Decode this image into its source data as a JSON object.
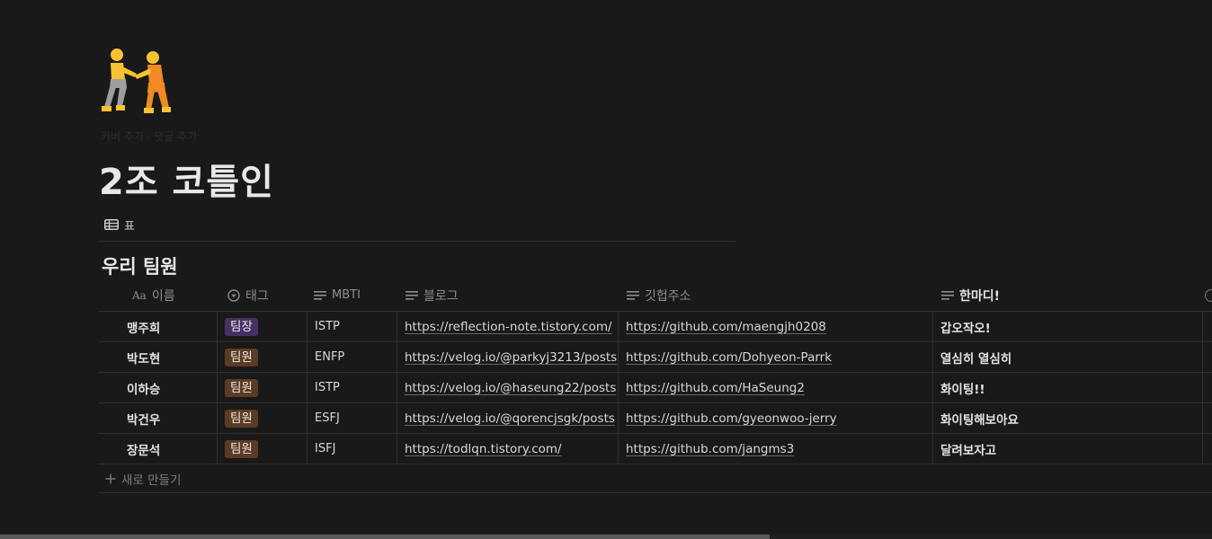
{
  "page": {
    "icon": "wrestlers-emoji",
    "hover_actions": "커버 추가  ·  댓글 추가",
    "title": "2조 코틀인"
  },
  "view": {
    "icon": "table-icon",
    "label": "표"
  },
  "database": {
    "title": "우리 팀원",
    "columns": [
      {
        "icon": "Aa",
        "label": "이름"
      },
      {
        "icon": "select-icon",
        "label": "태그"
      },
      {
        "icon": "text-icon",
        "label": "MBTI"
      },
      {
        "icon": "text-icon",
        "label": "블로그"
      },
      {
        "icon": "text-icon",
        "label": "깃헙주소"
      },
      {
        "icon": "text-icon",
        "label": "한마디!"
      }
    ],
    "rows": [
      {
        "name": "맹주희",
        "tag": "팀장",
        "mbti": "ISTP",
        "blog": "https://reflection-note.tistory.com/",
        "github": "https://github.com/maengjh0208",
        "comment": "갑오작오!"
      },
      {
        "name": "박도현",
        "tag": "팀원",
        "mbti": "ENFP",
        "blog": "https://velog.io/@parkyj3213/posts",
        "github": "https://github.com/Dohyeon-Parrk",
        "comment": "열심히 열심히"
      },
      {
        "name": "이하승",
        "tag": "팀원",
        "mbti": "ISTP",
        "blog": "https://velog.io/@haseung22/posts",
        "github": "https://github.com/HaSeung2",
        "comment": "화이팅!!"
      },
      {
        "name": "박건우",
        "tag": "팀원",
        "mbti": "ESFJ",
        "blog": "https://velog.io/@qorencjsgk/posts",
        "github": "https://github.com/gyeonwoo-jerry",
        "comment": "화이팅해보아요"
      },
      {
        "name": "장문석",
        "tag": "팀원",
        "mbti": "ISFJ",
        "blog": "https://todlqn.tistory.com/",
        "github": "https://github.com/jangms3",
        "comment": "달려보자고"
      }
    ],
    "new_row_label": "새로 만들기"
  },
  "tag_colors": {
    "팀장": "#492f64",
    "팀원": "#5c3b23"
  },
  "theme": {
    "background": "#191919",
    "text": "#d4d4d4",
    "muted": "#8d8d8d",
    "border": "#2f2f2f"
  }
}
